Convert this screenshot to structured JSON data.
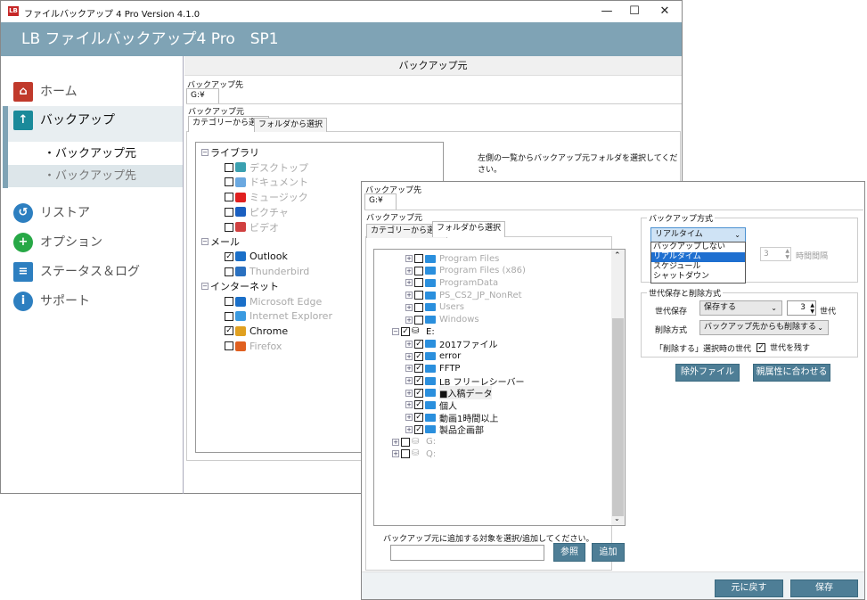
{
  "window": {
    "title": "ファイルバックアップ 4 Pro Version 4.1.0",
    "logo": "LB",
    "banner": "LB ファイルバックアップ4 Pro　SP1",
    "controls": [
      "—",
      "☐",
      "✕"
    ]
  },
  "sidebar": {
    "items": [
      {
        "label": "ホーム",
        "icon": "home-icon",
        "color": "#c0392b"
      },
      {
        "label": "バックアップ",
        "icon": "backup-icon",
        "color": "#1a8a9a",
        "selected": true
      },
      {
        "label": "リストア",
        "icon": "restore-icon",
        "color": "#2d7fc0"
      },
      {
        "label": "オプション",
        "icon": "plus-icon",
        "color": "#27a846"
      },
      {
        "label": "ステータス＆ログ",
        "icon": "clipboard-icon",
        "color": "#2d7fc0"
      },
      {
        "label": "サポート",
        "icon": "info-icon",
        "color": "#2d7fc0"
      }
    ],
    "subitems": [
      "・バックアップ元",
      "・バックアップ先"
    ]
  },
  "main": {
    "header": "バックアップ元",
    "dest_label": "バックアップ先",
    "dest_value": "G:¥",
    "src_label": "バックアップ元",
    "tabs": [
      "カテゴリーから選択",
      "フォルダから選択"
    ],
    "hint": "左側の一覧からバックアップ元フォルダを選択してください。",
    "tree": [
      {
        "label": "ライブラリ",
        "group": true
      },
      {
        "label": "デスクトップ",
        "checked": false,
        "icon": "desktop-icon",
        "c": "#3aa0b0"
      },
      {
        "label": "ドキュメント",
        "checked": false,
        "icon": "document-icon",
        "c": "#6aa8e0"
      },
      {
        "label": "ミュージック",
        "checked": false,
        "icon": "music-icon",
        "c": "#e02020"
      },
      {
        "label": "ピクチャ",
        "checked": false,
        "icon": "camera-icon",
        "c": "#1a5fc0"
      },
      {
        "label": "ビデオ",
        "checked": false,
        "icon": "video-icon",
        "c": "#d04040"
      },
      {
        "label": "メール",
        "group": true
      },
      {
        "label": "Outlook",
        "checked": true,
        "icon": "outlook-icon",
        "c": "#1a6fc8"
      },
      {
        "label": "Thunderbird",
        "checked": false,
        "icon": "thunderbird-icon",
        "c": "#2a70c0"
      },
      {
        "label": "インターネット",
        "group": true
      },
      {
        "label": "Microsoft Edge",
        "checked": false,
        "icon": "edge-icon",
        "c": "#1a6fc8"
      },
      {
        "label": "Internet Explorer",
        "checked": false,
        "icon": "ie-icon",
        "c": "#3a9ae0"
      },
      {
        "label": "Chrome",
        "checked": true,
        "icon": "chrome-icon",
        "c": "#e0a020"
      },
      {
        "label": "Firefox",
        "checked": false,
        "icon": "firefox-icon",
        "c": "#e06020"
      }
    ]
  },
  "dialog": {
    "dest_label": "バックアップ先",
    "dest_value": "G:¥",
    "src_label": "バックアップ元",
    "tabs": [
      "カテゴリーから選択",
      "フォルダから選択"
    ],
    "tree": [
      {
        "label": "Program Files",
        "checked": false,
        "level": 2,
        "muted": true
      },
      {
        "label": "Program Files (x86)",
        "checked": false,
        "level": 2,
        "muted": true
      },
      {
        "label": "ProgramData",
        "checked": false,
        "level": 2,
        "muted": true
      },
      {
        "label": "PS_CS2_JP_NonRet",
        "checked": false,
        "level": 2,
        "muted": true
      },
      {
        "label": "Users",
        "checked": false,
        "level": 2,
        "muted": true
      },
      {
        "label": "Windows",
        "checked": false,
        "level": 2,
        "muted": true
      },
      {
        "label": "E:",
        "checked": true,
        "level": 1,
        "drive": true,
        "expanded": true
      },
      {
        "label": "2017ファイル",
        "checked": true,
        "level": 2
      },
      {
        "label": "error",
        "checked": true,
        "level": 2
      },
      {
        "label": "FFTP",
        "checked": true,
        "level": 2
      },
      {
        "label": "LB フリーレシーバー",
        "checked": true,
        "level": 2
      },
      {
        "label": "■入稿データ",
        "checked": true,
        "level": 2,
        "highlight": true
      },
      {
        "label": "個人",
        "checked": true,
        "level": 2
      },
      {
        "label": "動画1時間以上",
        "checked": true,
        "level": 2
      },
      {
        "label": "製品企画部",
        "checked": true,
        "level": 2
      },
      {
        "label": "G:",
        "checked": false,
        "level": 1,
        "drive": true,
        "muted": true
      },
      {
        "label": "Q:",
        "checked": false,
        "level": 1,
        "drive": true,
        "muted": true
      }
    ],
    "add_hint": "バックアップ元に追加する対象を選択/追加してください。",
    "add_input": "",
    "browse": "参照",
    "add": "追加",
    "method": {
      "title": "バックアップ方式",
      "selected": "リアルタイム",
      "options": [
        "バックアップしない",
        "リアルタイム",
        "スケジュール",
        "シャットダウン"
      ],
      "interval_value": "3",
      "interval_unit": "時間間隔"
    },
    "gen": {
      "title": "世代保存と削除方式",
      "keep_label": "世代保存",
      "keep_value": "保存する",
      "count": "3",
      "count_unit": "世代",
      "delete_label": "削除方式",
      "delete_value": "バックアップ先からも削除する",
      "del_gen_label": "「削除する」選択時の世代",
      "keep_gen_checkbox": "世代を残す",
      "keep_gen_checked": true
    },
    "exclude": "除外ファイル",
    "attr": "親属性に合わせる",
    "revert": "元に戻す",
    "save": "保存"
  }
}
